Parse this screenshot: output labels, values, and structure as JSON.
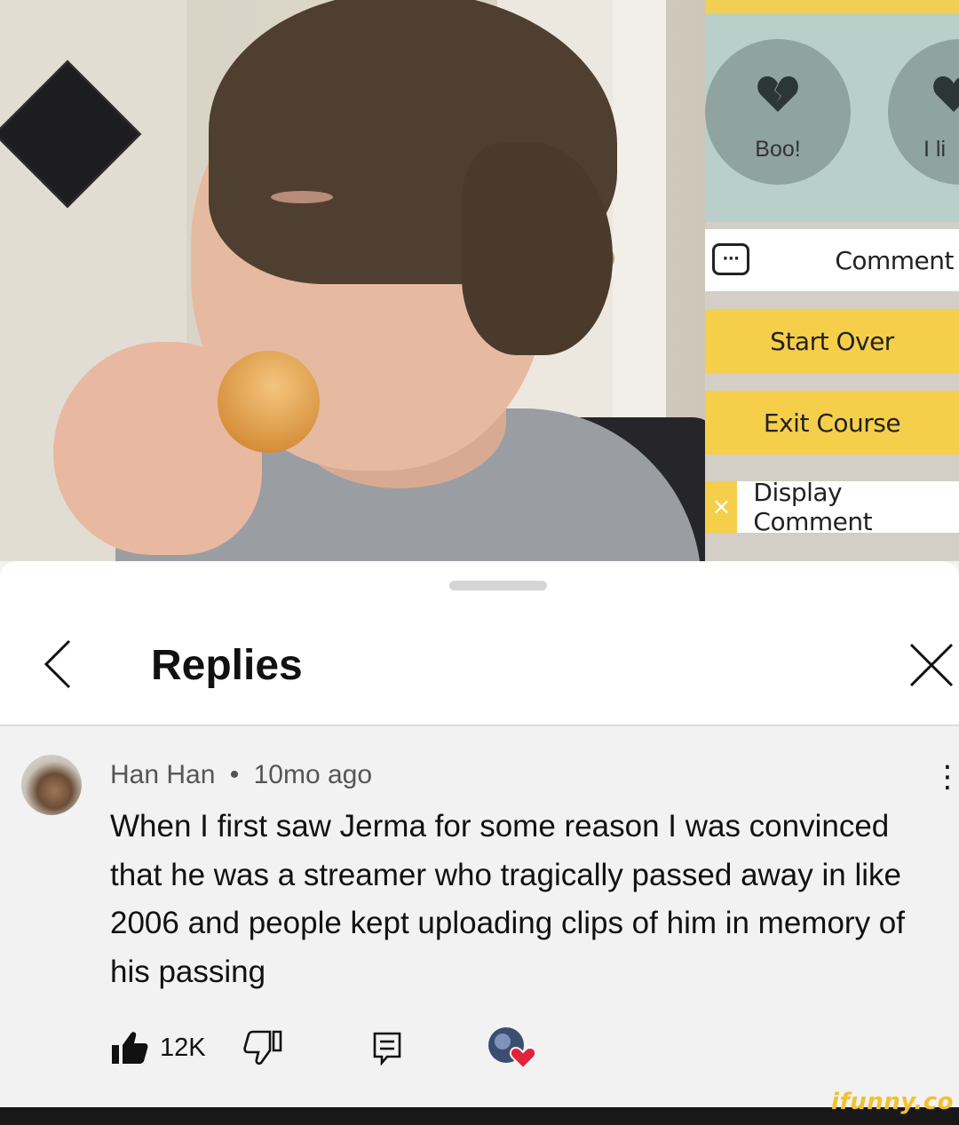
{
  "video": {
    "menu": {
      "boo_label": "Boo!",
      "like_label_partial": "I li",
      "comment_label": "Comment",
      "comment_icon": "chat-bubble-icon",
      "start_over_label": "Start Over",
      "exit_course_label": "Exit Course",
      "display_comments_label": "Display Comment",
      "display_comments_check": "×"
    }
  },
  "sheet": {
    "title": "Replies",
    "back_icon": "chevron-left-icon",
    "close_icon": "close-icon"
  },
  "comment": {
    "author": "Han Han",
    "separator": "•",
    "time": "10mo ago",
    "text": "When I first saw Jerma for some reason I was convinced that he was a streamer who tragically passed away in like 2006 and people kept uploading clips of him in memory of his passing",
    "likes": "12K"
  },
  "watermark": "ifunny.co",
  "colors": {
    "menu_yellow": "#f6cf4a",
    "sheet_bg": "#f2f2f2",
    "heart_red": "#e0223a"
  }
}
